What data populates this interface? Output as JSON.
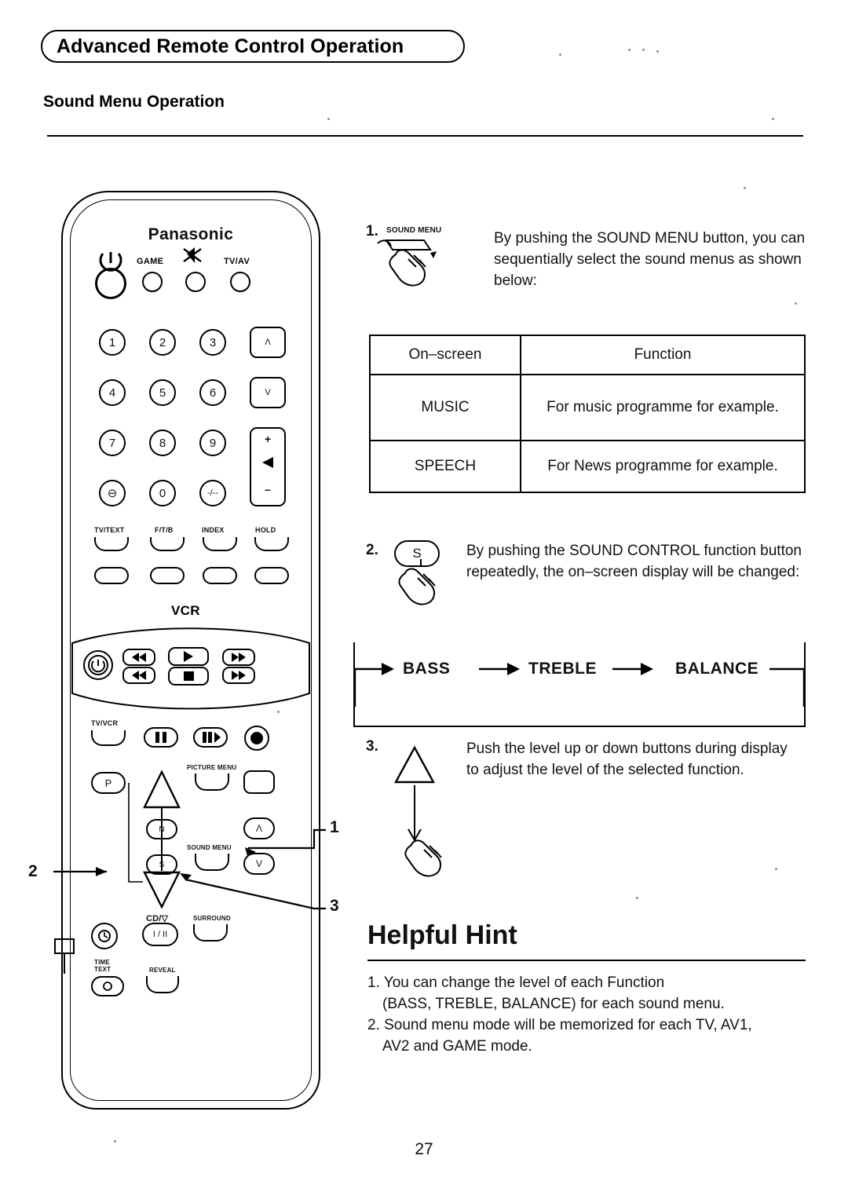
{
  "header": {
    "title": "Advanced Remote Control Operation",
    "section": "Sound Menu Operation"
  },
  "remote": {
    "brand": "Panasonic",
    "labels": {
      "power": "power-icon",
      "game": "GAME",
      "mute": "mute-icon",
      "tvav": "TV/AV",
      "tvtext": "TV/TEXT",
      "ftb": "F/T/B",
      "index": "INDEX",
      "hold": "HOLD",
      "vcr": "VCR",
      "tvvcr": "TV/VCR",
      "picture_menu": "PICTURE MENU",
      "sound_menu": "SOUND MENU",
      "surround": "SURROUND",
      "time_text": "TIME TEXT",
      "reveal": "REVEAL",
      "p": "P",
      "s": "S",
      "n": "N",
      "i_ii": "I / II",
      "stereo_icon": "CD/▽",
      "up": "Λ",
      "down": "V",
      "plus": "+",
      "minus": "–"
    },
    "numbers": [
      "1",
      "2",
      "3",
      "4",
      "5",
      "6",
      "7",
      "8",
      "9",
      "0"
    ],
    "extra_keys": [
      "⊖",
      "-/--"
    ]
  },
  "callouts": {
    "one": "1",
    "two": "2",
    "three": "3"
  },
  "steps": [
    {
      "num": "1.",
      "caption": "SOUND MENU",
      "text": "By pushing the SOUND MENU button, you can sequentially select the sound menus as shown below:"
    },
    {
      "num": "2.",
      "button": "S",
      "text": "By pushing the SOUND CONTROL function button repeatedly, the on–screen display will be changed:"
    },
    {
      "num": "3.",
      "text": "Push the level up or down buttons during display to adjust the level of the selected function."
    }
  ],
  "table": {
    "headers": [
      "On–screen",
      "Function"
    ],
    "rows": [
      [
        "MUSIC",
        "For music programme for example."
      ],
      [
        "SPEECH",
        "For News programme for example."
      ]
    ]
  },
  "flow": {
    "items": [
      "BASS",
      "TREBLE",
      "BALANCE"
    ]
  },
  "hint": {
    "title": "Helpful Hint",
    "line1": "1. You can change the level of each Function",
    "line1b": "(BASS, TREBLE, BALANCE) for each sound menu.",
    "line2": "2. Sound menu mode will be memorized for each TV, AV1,",
    "line2b": "AV2 and GAME mode."
  },
  "page_number": "27"
}
